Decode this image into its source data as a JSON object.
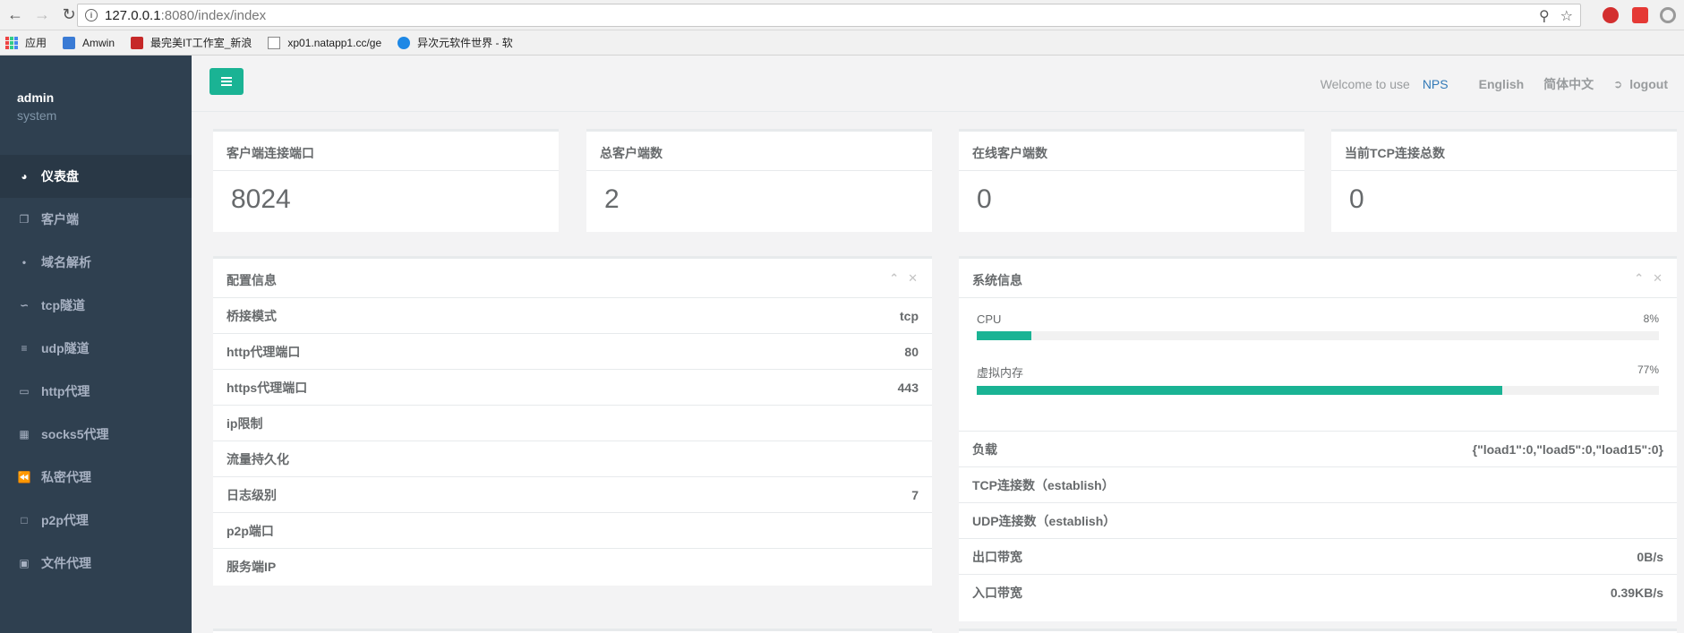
{
  "browser": {
    "url_host": "127.0.0.1",
    "url_rest": ":8080/index/index",
    "bookmarks": [
      "应用",
      "Amwin",
      "最完美IT工作室_新浪",
      "xp01.natapp1.cc/ge",
      "异次元软件世界 - 软"
    ]
  },
  "sidebar": {
    "user": "admin",
    "role": "system",
    "items": [
      {
        "label": "仪表盘",
        "icon": "dashboard-icon"
      },
      {
        "label": "客户端",
        "icon": "clients-icon"
      },
      {
        "label": "域名解析",
        "icon": "paperclip-icon"
      },
      {
        "label": "tcp隧道",
        "icon": "line-chart-icon"
      },
      {
        "label": "udp隧道",
        "icon": "server-icon"
      },
      {
        "label": "http代理",
        "icon": "html5-icon"
      },
      {
        "label": "socks5代理",
        "icon": "table-icon"
      },
      {
        "label": "私密代理",
        "icon": "backward-icon"
      },
      {
        "label": "p2p代理",
        "icon": "p2p-icon"
      },
      {
        "label": "文件代理",
        "icon": "laptop-icon"
      }
    ]
  },
  "topbar": {
    "welcome": "Welcome to use",
    "brand": "NPS",
    "lang_en": "English",
    "lang_zh": "简体中文",
    "logout": "logout"
  },
  "stats": [
    {
      "title": "客户端连接端口",
      "value": "8024"
    },
    {
      "title": "总客户端数",
      "value": "2"
    },
    {
      "title": "在线客户端数",
      "value": "0"
    },
    {
      "title": "当前TCP连接总数",
      "value": "0"
    }
  ],
  "config": {
    "title": "配置信息",
    "rows": [
      {
        "k": "桥接模式",
        "v": "tcp"
      },
      {
        "k": "http代理端口",
        "v": "80"
      },
      {
        "k": "https代理端口",
        "v": "443"
      },
      {
        "k": "ip限制",
        "v": ""
      },
      {
        "k": "流量持久化",
        "v": ""
      },
      {
        "k": "日志级别",
        "v": "7"
      },
      {
        "k": "p2p端口",
        "v": ""
      },
      {
        "k": "服务端IP",
        "v": ""
      }
    ]
  },
  "system": {
    "title": "系统信息",
    "cpu_label": "CPU",
    "cpu_pct": "8%",
    "cpu_value": 8,
    "mem_label": "虚拟内存",
    "mem_pct": "77%",
    "mem_value": 77,
    "rows": [
      {
        "k": "负载",
        "v": "{\"load1\":0,\"load5\":0,\"load15\":0}"
      },
      {
        "k": "TCP连接数（establish）",
        "v": ""
      },
      {
        "k": "UDP连接数（establish）",
        "v": ""
      },
      {
        "k": "出口带宽",
        "v": "0B/s"
      },
      {
        "k": "入口带宽",
        "v": "0.39KB/s"
      }
    ]
  },
  "colors": {
    "accent": "#1ab394",
    "sidebar": "#2f4050",
    "link": "#337ab7"
  }
}
